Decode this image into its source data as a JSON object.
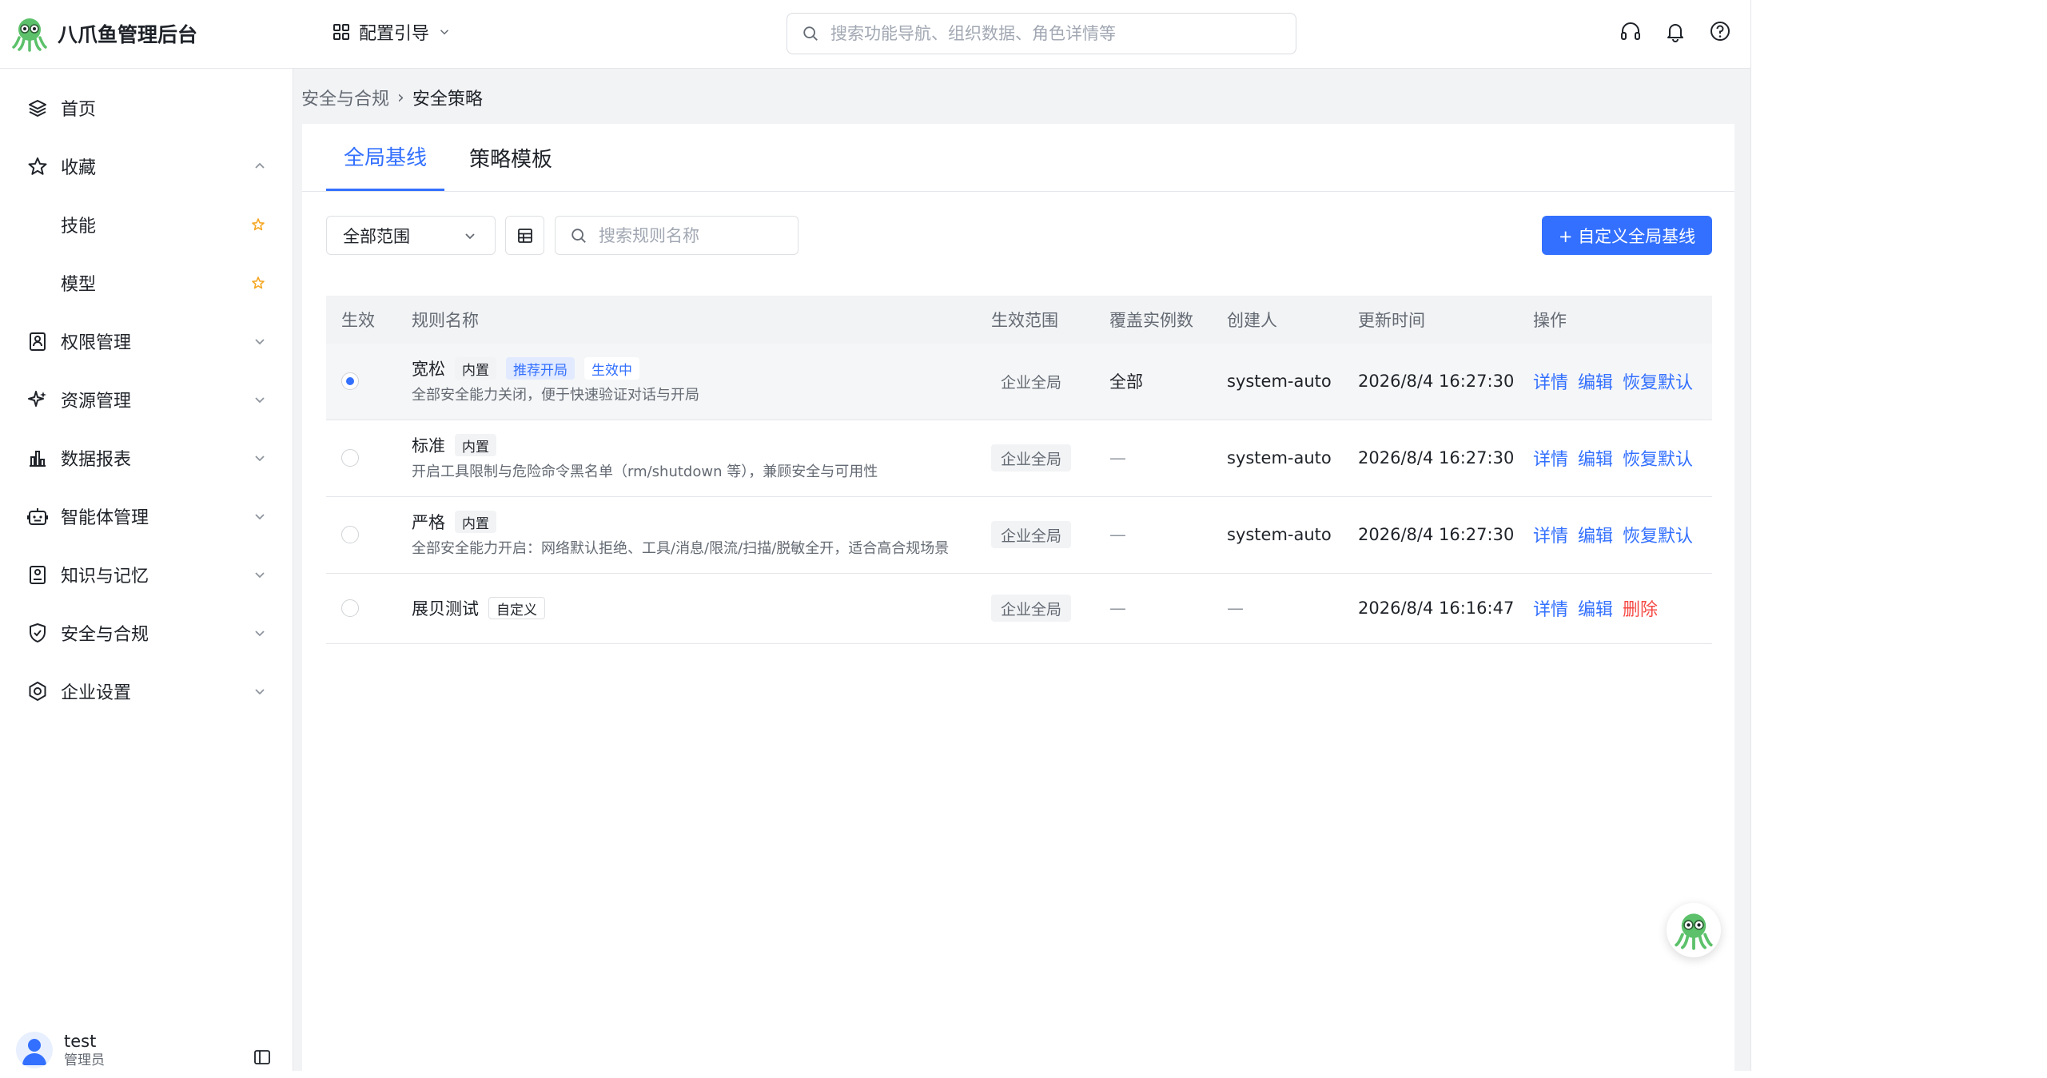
{
  "app": {
    "title": "八爪鱼管理后台"
  },
  "header": {
    "guide_label": "配置引导",
    "search_placeholder": "搜索功能导航、组织数据、角色详情等"
  },
  "sidebar": {
    "items": [
      {
        "label": "首页",
        "icon": "layers-icon"
      },
      {
        "label": "收藏",
        "icon": "star-icon"
      },
      {
        "label": "技能",
        "icon": "star-filled-icon"
      },
      {
        "label": "模型",
        "icon": "star-filled-icon"
      },
      {
        "label": "权限管理",
        "icon": "id-card-icon"
      },
      {
        "label": "资源管理",
        "icon": "sparkle-icon"
      },
      {
        "label": "数据报表",
        "icon": "bar-chart-icon"
      },
      {
        "label": "智能体管理",
        "icon": "robot-icon"
      },
      {
        "label": "知识与记忆",
        "icon": "memory-icon"
      },
      {
        "label": "安全与合规",
        "icon": "shield-icon"
      },
      {
        "label": "企业设置",
        "icon": "settings-icon"
      }
    ],
    "user": {
      "name": "test",
      "role": "管理员"
    }
  },
  "breadcrumb": {
    "parent": "安全与合规",
    "separator": "›",
    "current": "安全策略"
  },
  "tabs": [
    {
      "label": "全局基线"
    },
    {
      "label": "策略模板"
    }
  ],
  "toolbar": {
    "scope_value": "全部范围",
    "search_placeholder": "搜索规则名称",
    "add_label": "+ 自定义全局基线"
  },
  "table": {
    "headers": [
      "生效",
      "规则名称",
      "生效范围",
      "覆盖实例数",
      "创建人",
      "更新时间",
      "操作"
    ],
    "rows": [
      {
        "active": true,
        "name": "宽松",
        "tags": [
          "内置",
          "推荐开局",
          "生效中"
        ],
        "desc": "全部安全能力关闭，便于快速验证对话与开局",
        "scope": "企业全局",
        "coverage": "全部",
        "creator": "system-auto",
        "updated": "2026/8/4 16:27:30",
        "actions": [
          "详情",
          "编辑",
          "恢复默认"
        ]
      },
      {
        "active": false,
        "name": "标准",
        "tags": [
          "内置"
        ],
        "desc": "开启工具限制与危险命令黑名单（rm/shutdown 等），兼顾安全与可用性",
        "scope": "企业全局",
        "coverage": "—",
        "creator": "system-auto",
        "updated": "2026/8/4 16:27:30",
        "actions": [
          "详情",
          "编辑",
          "恢复默认"
        ]
      },
      {
        "active": false,
        "name": "严格",
        "tags": [
          "内置"
        ],
        "desc": "全部安全能力开启：网络默认拒绝、工具/消息/限流/扫描/脱敏全开，适合高合规场景",
        "scope": "企业全局",
        "coverage": "—",
        "creator": "system-auto",
        "updated": "2026/8/4 16:27:30",
        "actions": [
          "详情",
          "编辑",
          "恢复默认"
        ]
      },
      {
        "active": false,
        "name": "展贝测试",
        "tags": [
          "自定义"
        ],
        "desc": "",
        "scope": "企业全局",
        "coverage": "—",
        "creator": "—",
        "updated": "2026/8/4 16:16:47",
        "actions": [
          "详情",
          "编辑",
          "删除"
        ]
      }
    ]
  },
  "colors": {
    "accent": "#3370ff",
    "danger": "#f54a45",
    "star": "#f5a623"
  }
}
